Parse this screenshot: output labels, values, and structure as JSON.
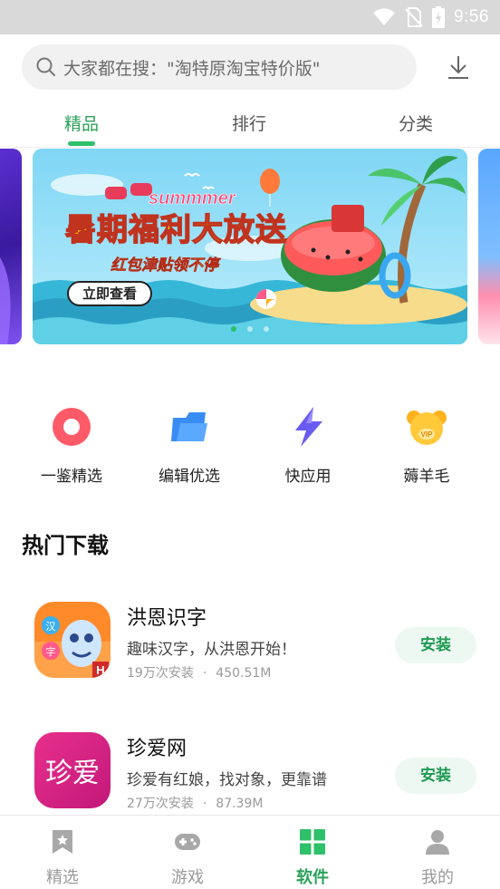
{
  "status_bar": {
    "time": "9:56"
  },
  "search": {
    "placeholder": "大家都在搜：\"淘特原淘宝特价版\""
  },
  "tabs": [
    {
      "label": "精品",
      "active": true
    },
    {
      "label": "排行",
      "active": false
    },
    {
      "label": "分类",
      "active": false
    }
  ],
  "banner": {
    "title": "暑期福利大放送",
    "tag": "summmer",
    "subtitle": "红包津贴领不停",
    "cta": "立即查看",
    "page_count": 3,
    "active_index": 0
  },
  "quick_entries": [
    {
      "label": "一鉴精选",
      "icon": "ring-icon"
    },
    {
      "label": "编辑优选",
      "icon": "folder-icon"
    },
    {
      "label": "快应用",
      "icon": "lightning-icon"
    },
    {
      "label": "薅羊毛",
      "icon": "sheep-icon"
    }
  ],
  "section": {
    "title": "热门下载"
  },
  "apps": [
    {
      "name": "洪恩识字",
      "desc": "趣味汉字，从洪恩开始！",
      "downloads": "19万次安装",
      "separator": "·",
      "size": "450.51M",
      "install_label": "安装",
      "icon_text": [
        "汉",
        "字",
        "H"
      ]
    },
    {
      "name": "珍爱网",
      "desc": "珍爱有红娘，找对象，更靠谱",
      "downloads": "27万次安装",
      "separator": "·",
      "size": "87.39M",
      "install_label": "安装",
      "icon_text": "珍爱"
    }
  ],
  "bottom_nav": [
    {
      "label": "精选",
      "icon": "bookmark-star-icon",
      "active": false
    },
    {
      "label": "游戏",
      "icon": "gamepad-icon",
      "active": false
    },
    {
      "label": "软件",
      "icon": "apps-grid-icon",
      "active": true
    },
    {
      "label": "我的",
      "icon": "person-icon",
      "active": false
    }
  ],
  "colors": {
    "accent": "#2aa15a",
    "install_bg": "#eef8f2",
    "status_bar": "#d9d9d9"
  }
}
